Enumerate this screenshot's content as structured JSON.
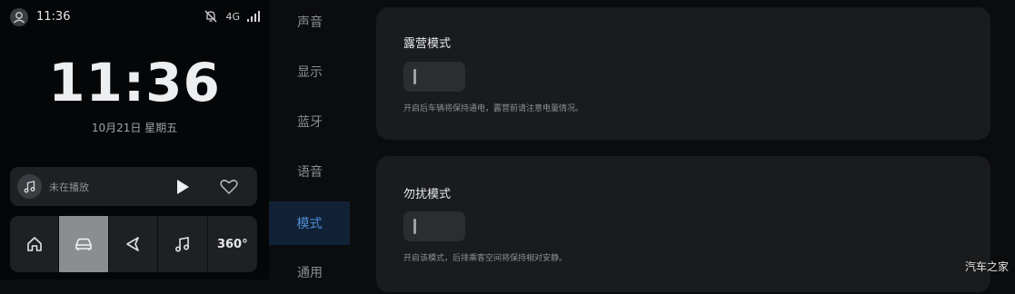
{
  "status_bar": {
    "time": "11:36",
    "network": "4G"
  },
  "clock": {
    "time": "11:36",
    "date": "10月21日 星期五"
  },
  "player": {
    "status": "未在播放"
  },
  "dock": {
    "buttons": [
      {
        "icon": "home-icon"
      },
      {
        "icon": "car-icon",
        "active": true
      },
      {
        "icon": "navigation-icon"
      },
      {
        "icon": "music-icon"
      },
      {
        "icon": "360-view-icon",
        "label": "360°"
      }
    ]
  },
  "nav": {
    "items": [
      {
        "label": "声音"
      },
      {
        "label": "显示"
      },
      {
        "label": "蓝牙"
      },
      {
        "label": "语音"
      },
      {
        "label": "模式",
        "active": true
      },
      {
        "label": "通用"
      }
    ]
  },
  "settings": {
    "camping": {
      "title": "露营模式",
      "enabled": false,
      "description": "开启后车辆将保持通电，露营前请注意电量情况。"
    },
    "dnd": {
      "title": "勿扰模式",
      "enabled": false,
      "description": "开启该模式，后排乘客空间将保持相对安静。"
    }
  },
  "watermark": "汽车之家",
  "colors": {
    "accent": "#4f8cd6",
    "active_nav_bg": "#122236",
    "card_bg": "#1a1b1d"
  }
}
